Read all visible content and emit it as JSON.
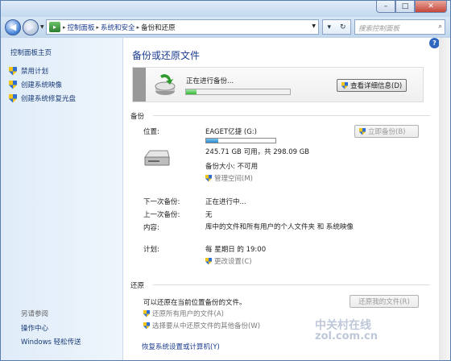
{
  "window": {
    "minimize": "–",
    "maximize": "□",
    "close": "✕"
  },
  "address": {
    "crumbs": [
      "控制面板",
      "系统和安全",
      "备份和还原"
    ]
  },
  "search": {
    "placeholder": "搜索控制面板"
  },
  "sidebar": {
    "home": "控制面板主页",
    "items": [
      {
        "label": "禁用计划",
        "icon": "shield-icon"
      },
      {
        "label": "创建系统映像",
        "icon": "shield-icon"
      },
      {
        "label": "创建系统修复光盘",
        "icon": "shield-icon"
      }
    ],
    "see_also": "另请参阅",
    "bottom": [
      {
        "label": "操作中心"
      },
      {
        "label": "Windows 轻松传送"
      }
    ]
  },
  "main": {
    "title": "备份或还原文件",
    "progress": {
      "text": "正在进行备份...",
      "fraction": 0.1,
      "button": "查看详细信息(D)"
    },
    "backup": {
      "section": "备份",
      "location_label": "位置:",
      "drive_name": "EAGET亿捷 (G:)",
      "drive_used_fraction": 0.17,
      "space_text": "245.71 GB 可用，共 298.09 GB",
      "backup_size": "备份大小: 不可用",
      "manage_space": "管理空间(M)",
      "backup_now": "立即备份(B)",
      "rows": [
        {
          "label": "下一次备份:",
          "value": "正在进行中..."
        },
        {
          "label": "上一次备份:",
          "value": "无"
        },
        {
          "label": "内容:",
          "value": "库中的文件和所有用户的个人文件夹 和 系统映像"
        },
        {
          "label": "计划:",
          "value": "每 星期日 的 19:00"
        }
      ],
      "change_settings": "更改设置(C)"
    },
    "restore": {
      "section": "还原",
      "desc": "可以还原在当前位置备份的文件。",
      "restore_mine": "还原我的文件(R)",
      "restore_all": "还原所有用户的文件(A)",
      "select_other": "选择要从中还原文件的其他备份(W)",
      "recover_link": "恢复系统设置或计算机(Y)"
    }
  },
  "watermark": {
    "line1": "中关村在线",
    "line2": "zol.com.cn"
  },
  "colors": {
    "link": "#1a3b8f",
    "progress_green": "#33b833",
    "drive_blue": "#2b8cd1"
  }
}
